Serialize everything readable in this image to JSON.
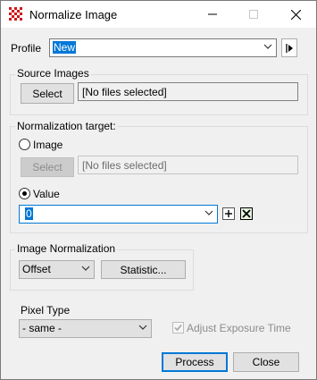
{
  "window": {
    "title": "Normalize Image"
  },
  "profile": {
    "label": "Profile",
    "value": "New"
  },
  "source": {
    "heading": "Source Images",
    "select_label": "Select",
    "files_text": "[No files selected]"
  },
  "target": {
    "heading": "Normalization target:",
    "image_option": "Image",
    "select_label": "Select",
    "files_text": "[No files selected]",
    "value_option": "Value",
    "value": "0",
    "selected_option": "Value"
  },
  "image_normalization": {
    "heading": "Image Normalization",
    "method": "Offset",
    "statistic_label": "Statistic..."
  },
  "pixel_type": {
    "heading": "Pixel Type",
    "value": "- same -"
  },
  "adjust_exposure": {
    "label": "Adjust Exposure Time",
    "checked": true,
    "enabled": false
  },
  "actions": {
    "process_label": "Process",
    "close_label": "Close"
  }
}
